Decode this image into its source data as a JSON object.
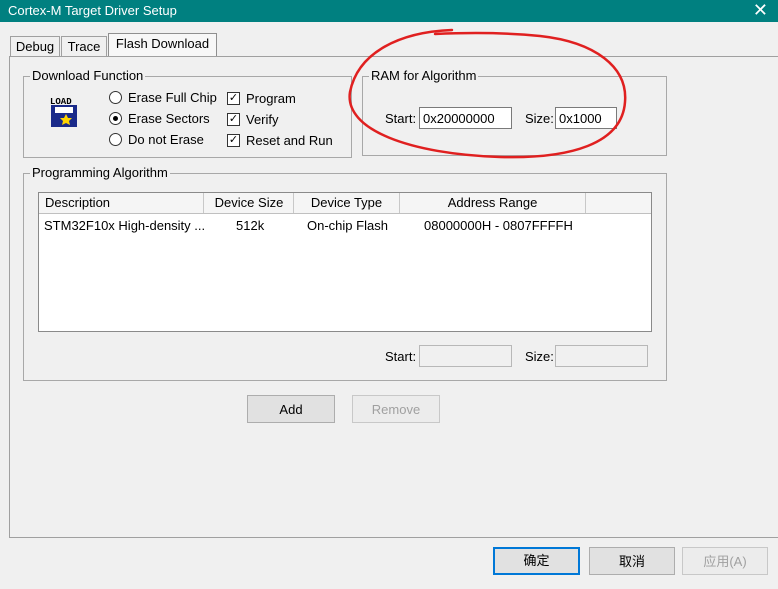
{
  "window": {
    "title": "Cortex-M Target Driver Setup",
    "close_glyph": "✕"
  },
  "tabs": [
    {
      "label": "Debug"
    },
    {
      "label": "Trace"
    },
    {
      "label": "Flash Download"
    }
  ],
  "download_function": {
    "legend": "Download Function",
    "icon": "load-icon",
    "icon_text": "LOAD",
    "erase_options": [
      {
        "label": "Erase Full Chip",
        "selected": false
      },
      {
        "label": "Erase Sectors",
        "selected": true
      },
      {
        "label": "Do not Erase",
        "selected": false
      }
    ],
    "checks": [
      {
        "label": "Program",
        "checked": true
      },
      {
        "label": "Verify",
        "checked": true
      },
      {
        "label": "Reset and Run",
        "checked": true
      }
    ]
  },
  "ram_for_algorithm": {
    "legend": "RAM for Algorithm",
    "start_label": "Start:",
    "start_value": "0x20000000",
    "size_label": "Size:",
    "size_value": "0x1000",
    "annotation_color": "#e02020"
  },
  "programming_algorithm": {
    "legend": "Programming Algorithm",
    "columns": [
      "Description",
      "Device Size",
      "Device Type",
      "Address Range"
    ],
    "rows": [
      {
        "description": "STM32F10x High-density ...",
        "size": "512k",
        "type": "On-chip Flash",
        "range": "08000000H - 0807FFFFH"
      }
    ],
    "start_label": "Start:",
    "start_value": "",
    "size_label": "Size:",
    "size_value": ""
  },
  "buttons": {
    "add": "Add",
    "remove": "Remove",
    "ok": "确定",
    "cancel": "取消",
    "apply": "应用(A)"
  },
  "colors": {
    "titlebar": "#008080",
    "accent": "#0078d7"
  }
}
